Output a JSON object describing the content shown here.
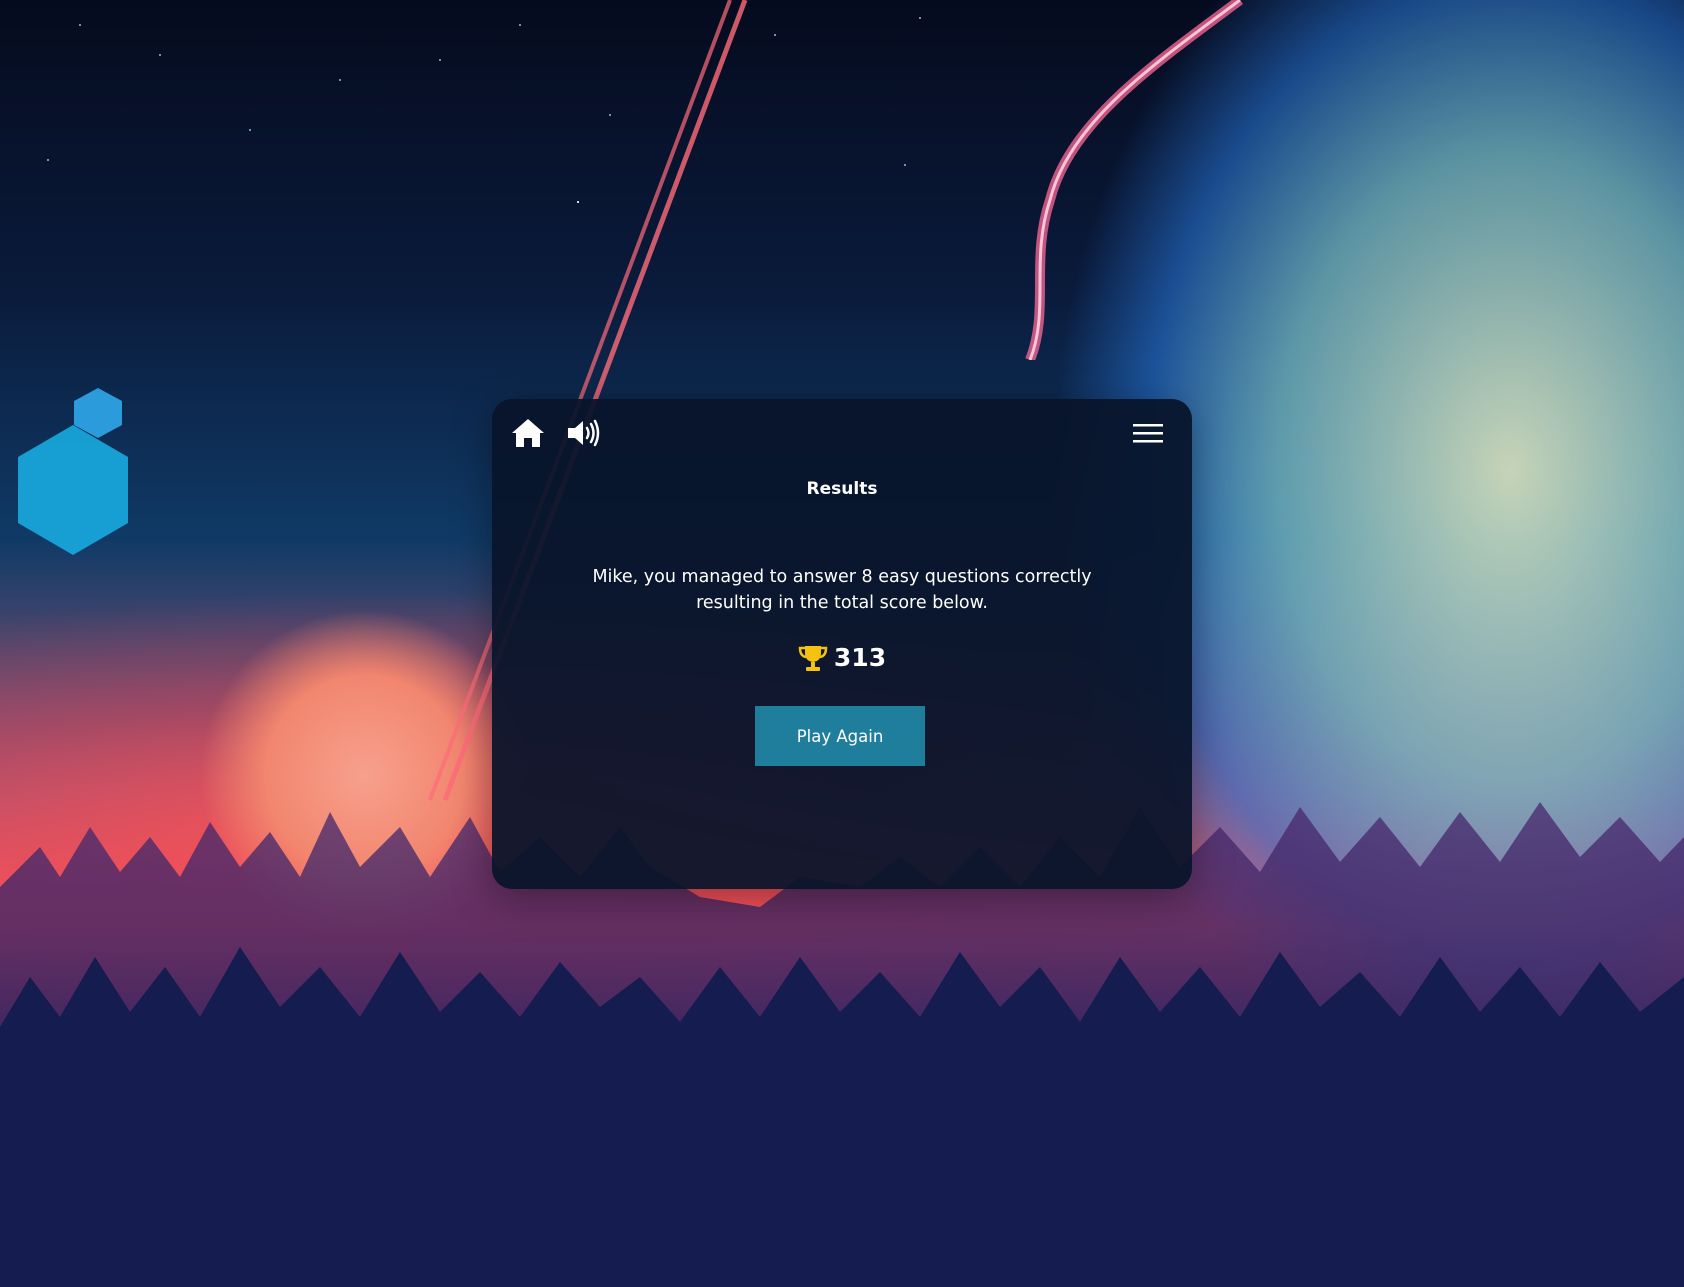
{
  "toolbar": {
    "home_icon": "home-icon",
    "sound_icon": "sound-on-icon",
    "menu_icon": "hamburger-menu-icon"
  },
  "results": {
    "title": "Results",
    "message": "Mike, you managed to answer 8 easy questions correctly resulting in the total score below.",
    "score_icon": "trophy-icon",
    "score": "313",
    "play_again_label": "Play Again"
  },
  "colors": {
    "panel_background": "#08142a",
    "button_background": "#1e7e9b",
    "trophy": "#f5c211",
    "text": "#ffffff"
  }
}
